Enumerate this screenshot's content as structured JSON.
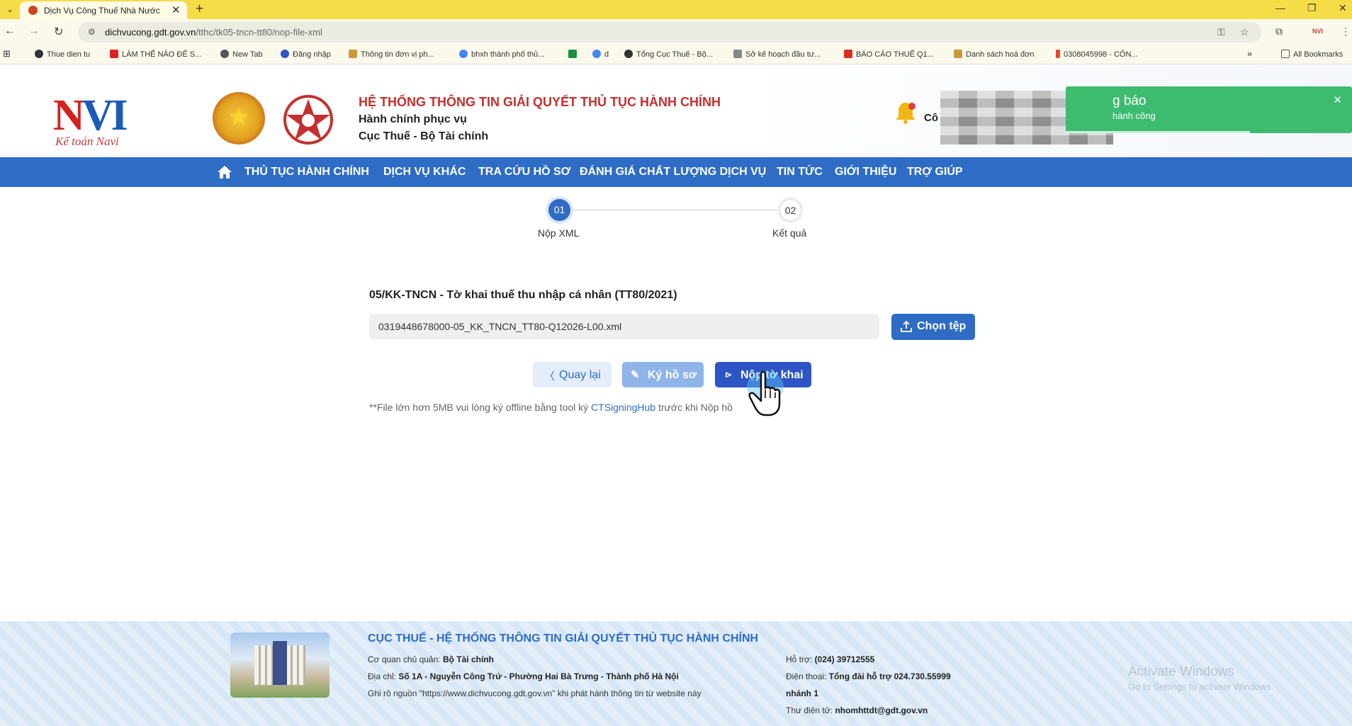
{
  "browser": {
    "tab_title": "Dịch Vụ Công Thuế Nhà Nước",
    "url_host": "dichvucong.gdt.gov.vn",
    "url_path": "/tthc/tk05-tncn-tt80/nop-file-xml",
    "bookmarks": [
      "Thue dien tu",
      "LÀM THẾ NÀO ĐỂ S...",
      "New Tab",
      "Đăng nhập",
      "Thông tin đơn vị ph...",
      "bhxh thành phố thủ...",
      "d",
      "Tổng Cục Thuế - Bộ...",
      "Sở kế hoạch đầu tư...",
      "BÁO CÁO THUẾ Q1...",
      "Danh sách hoá đơn",
      "0308045998 - CÔN...",
      "All Bookmarks"
    ]
  },
  "header": {
    "logo_text_a": "N",
    "logo_text_b": "VI",
    "logo_script": "Kế toán Navi",
    "system_title": "HỆ THỐNG THÔNG TIN GIẢI QUYẾT THỦ TỤC HÀNH CHÍNH",
    "subtitle1": "Hành chính phục vụ",
    "subtitle2": "Cục Thuế - Bộ Tài chính",
    "bell_label": "Cô"
  },
  "toast": {
    "title": "g báo",
    "message": "hành công"
  },
  "nav": {
    "items": [
      "THỦ TỤC HÀNH CHÍNH",
      "DỊCH VỤ KHÁC",
      "TRA CỨU HỒ SƠ",
      "ĐÁNH GIÁ CHẤT LƯỢNG DỊCH VỤ",
      "TIN TỨC",
      "GIỚI THIỆU",
      "TRỢ GIÚP"
    ]
  },
  "stepper": {
    "steps": [
      {
        "num": "01",
        "label": "Nộp XML"
      },
      {
        "num": "02",
        "label": "Kết quả"
      }
    ]
  },
  "form": {
    "title": "05/KK-TNCN - Tờ khai thuế thu nhập cá nhân (TT80/2021)",
    "file_value": "0319448678000-05_KK_TNCN_TT80-Q12026-L00.xml",
    "choose_label": "Chọn tệp",
    "back_label": "Quay lại",
    "sign_label": "Ký hồ sơ",
    "submit_label": "Nộp tờ khai",
    "note_prefix": "**File lớn hơn 5MB vui lòng ký offline bằng tool ký ",
    "note_link": "CTSigningHub",
    "note_suffix": " trước khi Nộp hồ"
  },
  "footer": {
    "title": "CỤC THUẾ - HỆ THỐNG THÔNG TIN GIẢI QUYẾT THỦ TỤC HÀNH CHÍNH",
    "agency_label": "Cơ quan chủ quản:",
    "agency_value": "Bộ Tài chính",
    "address_label": "Địa chỉ:",
    "address_value": "Số 1A - Nguyễn Công Trứ - Phường Hai Bà Trưng - Thành phố Hà Nội",
    "source_note": "Ghi rõ nguồn \"https://www.dichvucong.gdt.gov.vn\" khi phát hành thông tin từ website này",
    "support_label": "Hỗ trợ:",
    "support_value": "(024) 39712555",
    "phone_label": "Điện thoại:",
    "phone_value": "Tổng đài hỗ trợ 024.730.55999",
    "phone_value2": "nhánh 1",
    "email_label": "Thư điện tử:",
    "email_value": "nhomhttdt@gdt.gov.vn"
  },
  "watermark": {
    "line1": "Activate Windows",
    "line2": "Go to Settings to activate Windows."
  }
}
